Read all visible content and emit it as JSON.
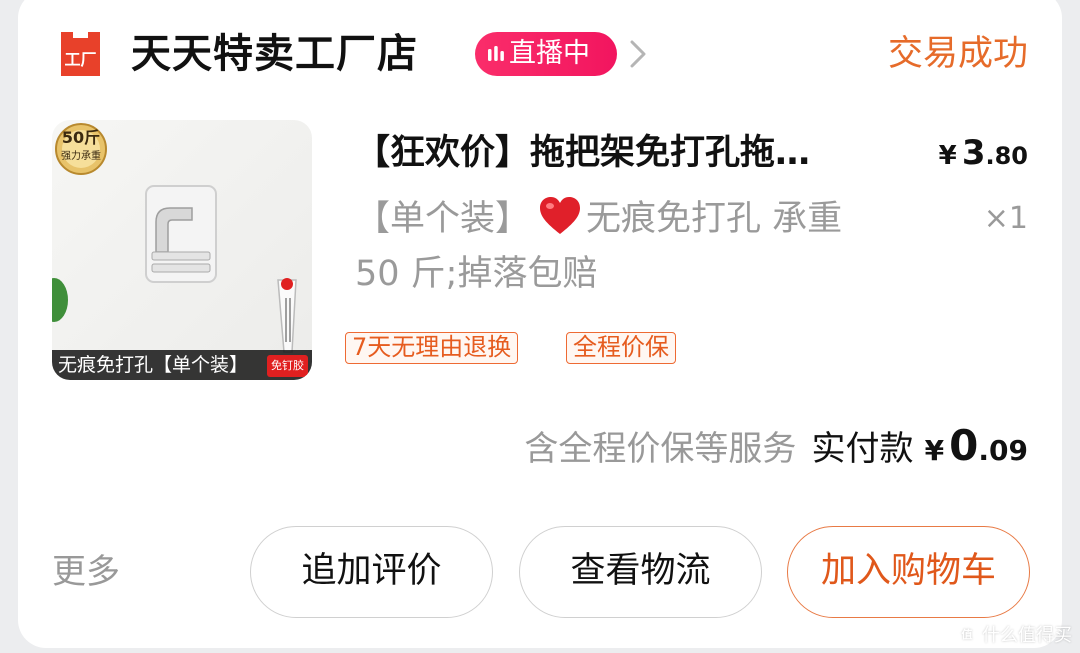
{
  "header": {
    "shop_name": "天天特卖工厂店",
    "logo_icon": "store-tag-icon",
    "logo_text": "工厂",
    "live_badge": "直播中",
    "live_icon": "live-bars-icon",
    "chevron_icon": "chevron-right-icon",
    "order_status": "交易成功"
  },
  "product": {
    "image_caption": "无痕免打孔【单个装】",
    "image_tag": "免钉胶",
    "seal_main": "50斤",
    "seal_sub": "强力承重",
    "title": "【狂欢价】拖把架免打孔拖…",
    "price": {
      "currency": "¥",
      "integer": "3",
      "decimal": ".80"
    },
    "sku_prefix": "【单个装】",
    "sku_heart_icon": "red-heart-icon",
    "sku_line1": "无痕免打孔 承重",
    "sku_line2": "50 斤;掉落包赔",
    "quantity": "×1",
    "service_tags": [
      "7天无理由退换",
      "全程价保"
    ]
  },
  "payment": {
    "service_note": "含全程价保等服务",
    "label": "实付款",
    "currency": "¥",
    "integer": "0",
    "decimal": ".09"
  },
  "actions": {
    "more": "更多",
    "review": "追加评价",
    "logistics": "查看物流",
    "cart": "加入购物车"
  },
  "watermark": {
    "text": "什么值得买",
    "icon": "smzdm-logo-icon"
  },
  "colors": {
    "accent_orange": "#e66b2a",
    "live_pink": "#f2155f",
    "tag_orange": "#ee6a33",
    "logo_red": "#e8412a"
  }
}
